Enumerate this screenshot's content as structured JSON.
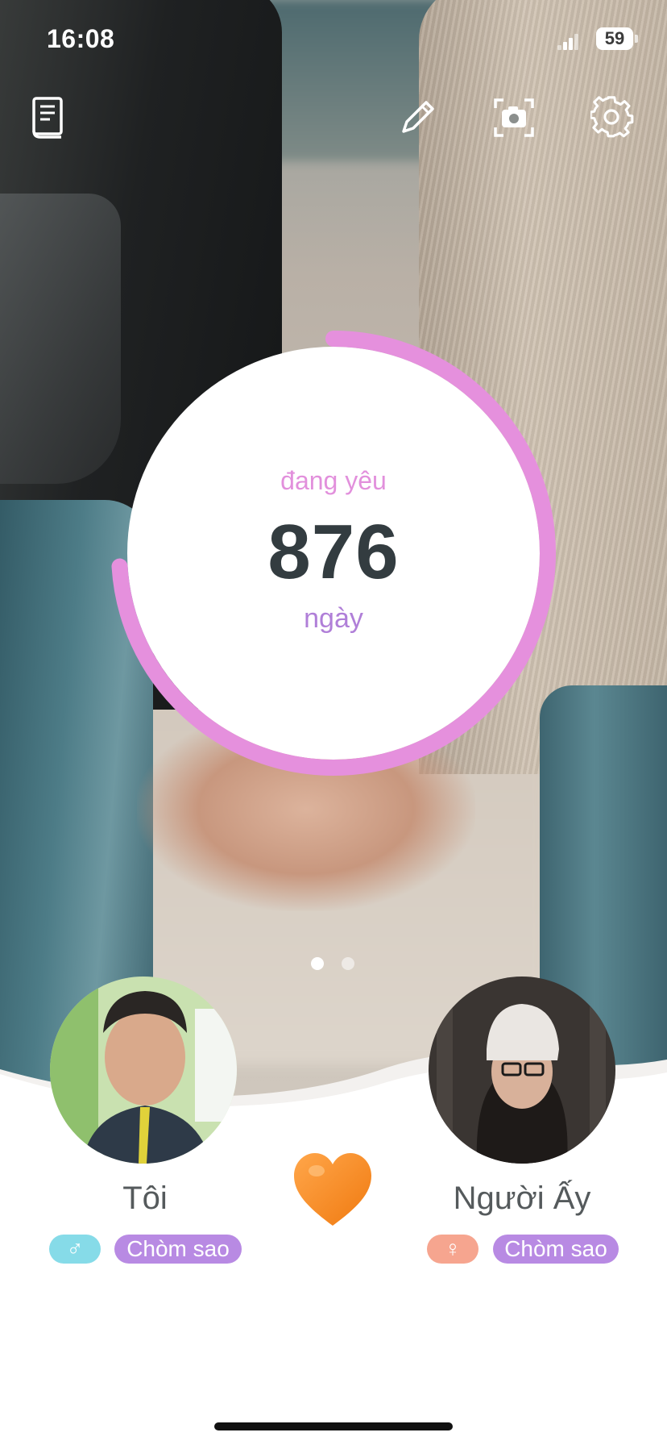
{
  "status_bar": {
    "time": "16:08",
    "battery": "59"
  },
  "toolbar": {
    "left_icon": "book-icon",
    "right_icons": [
      "pencil-icon",
      "camera-icon",
      "gear-icon"
    ]
  },
  "counter": {
    "label_top": "đang yêu",
    "value": "876",
    "label_bottom": "ngày",
    "progress_fraction": 0.74,
    "ring_color": "#e590dd"
  },
  "pager": {
    "pages": 2,
    "active": 1
  },
  "left_person": {
    "name": "Tôi",
    "gender_symbol": "♂",
    "zodiac_label": "Chòm sao"
  },
  "right_person": {
    "name": "Người Ấy",
    "gender_symbol": "♀",
    "zodiac_label": "Chòm sao"
  },
  "heart_icon": "orange-heart-icon",
  "colors": {
    "zodiac_tag": "#b88ae3",
    "male_tag": "#86dbe8",
    "female_tag": "#f6a58f",
    "label_pink": "#e290dc",
    "label_purple": "#b07fd8"
  }
}
